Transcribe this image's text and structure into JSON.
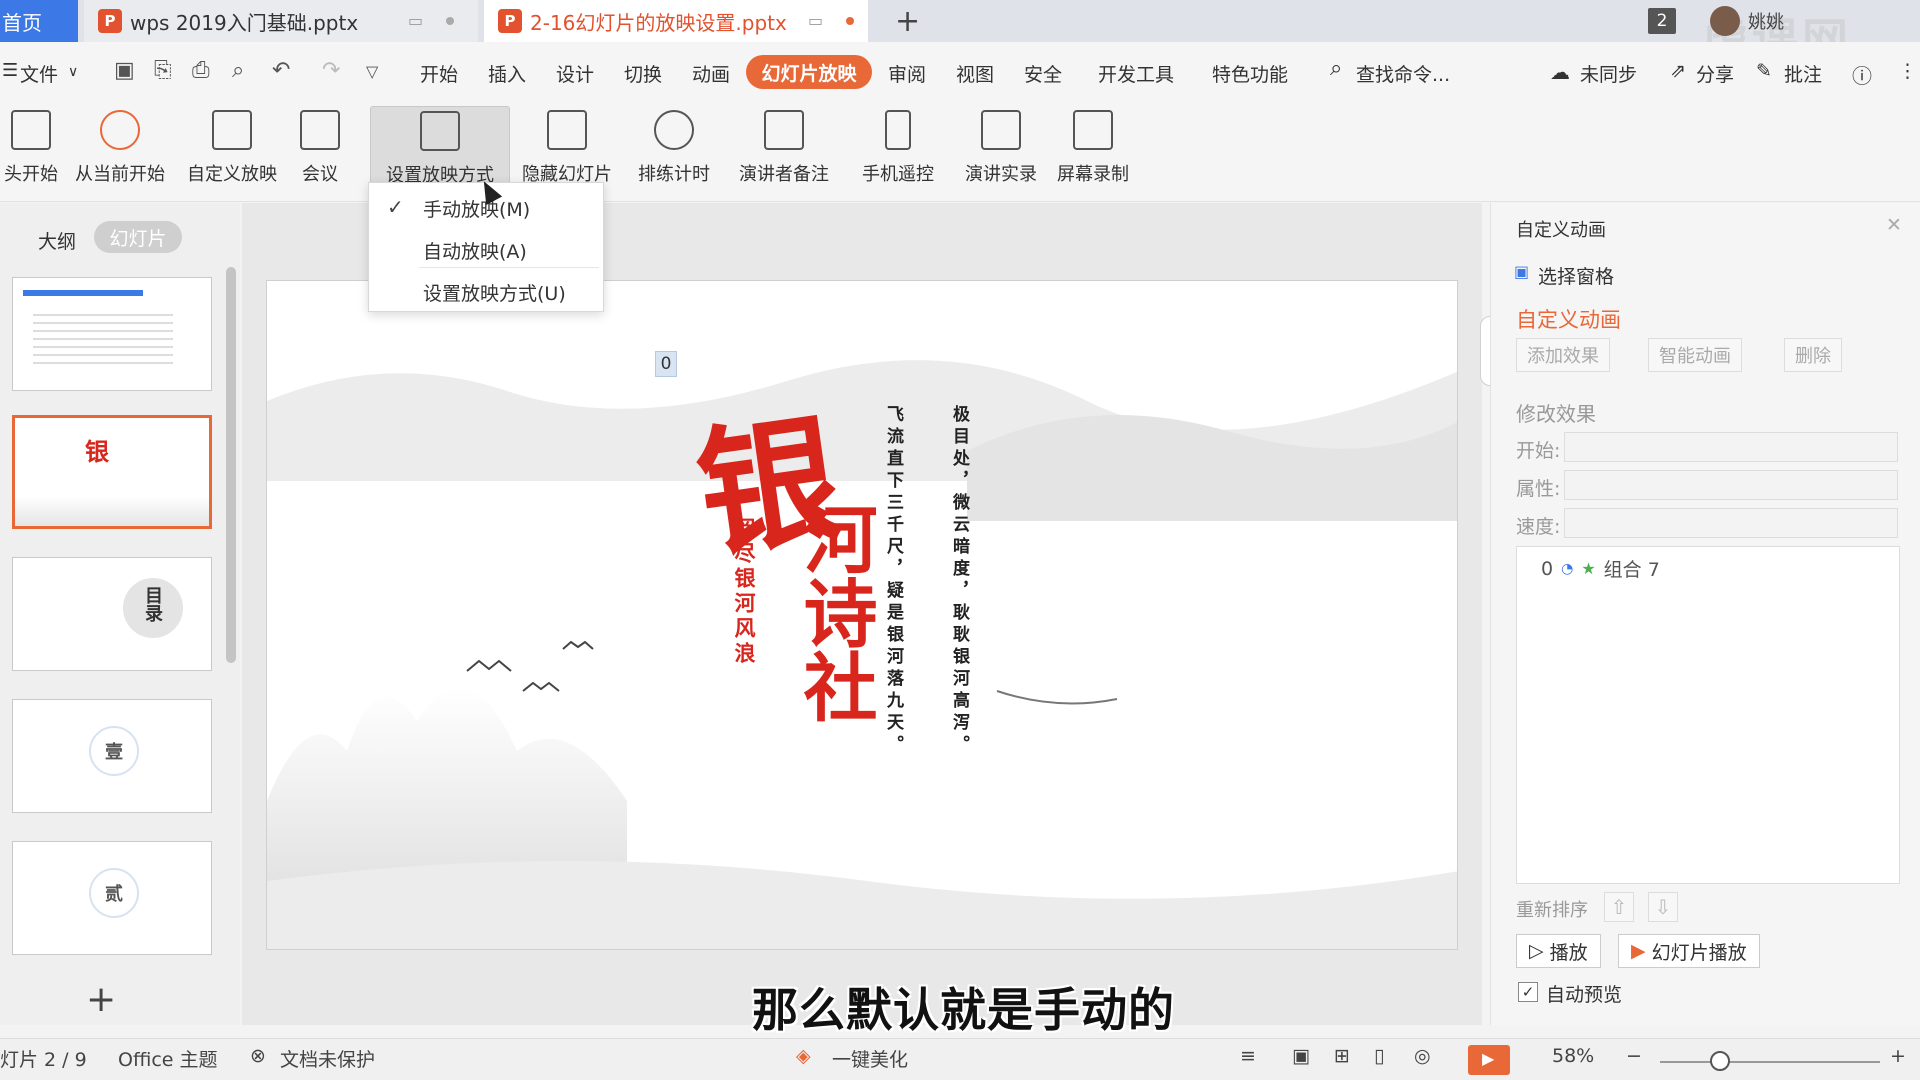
{
  "tabs": {
    "home": "首页",
    "file1": "wps 2019入门基础.pptx",
    "file2": "2-16幻灯片的放映设置.pptx",
    "window_count": "2",
    "user_name": "姚姚",
    "watermark": "虎课网"
  },
  "menu": {
    "file": "文件",
    "items": [
      "开始",
      "插入",
      "设计",
      "切换",
      "动画",
      "幻灯片放映",
      "审阅",
      "视图",
      "安全",
      "开发工具",
      "特色功能"
    ],
    "search": "查找命令...",
    "sync": "未同步",
    "share": "分享",
    "comment": "批注"
  },
  "ribbon": {
    "b0": "头开始",
    "b1": "从当前开始",
    "b2": "自定义放映",
    "b3": "会议",
    "b4": "设置放映方式",
    "b5": "隐藏幻灯片",
    "b6": "排练计时",
    "b7": "演讲者备注",
    "b8": "手机遥控",
    "b9": "演讲实录",
    "b10": "屏幕录制"
  },
  "dropdown": {
    "manual": "手动放映(M)",
    "auto": "自动放映(A)",
    "settings": "设置放映方式(U)"
  },
  "left_panel": {
    "outline_tab": "大纲",
    "slides_tab": "幻灯片"
  },
  "slide": {
    "title_first": "银",
    "title_rest": "河诗社",
    "subtitle": "阅尽银河风浪",
    "poem_col1": "飞流直下三千尺，疑是银河落九天。",
    "poem_col2": "极目处，微云暗度，耿耿银河高泻。",
    "anim_marker": "0",
    "thumb3_char": "目录",
    "thumb4_char": "壹",
    "thumb5_char": "贰"
  },
  "right_panel": {
    "header": "自定义动画",
    "select_pane": "选择窗格",
    "section_title": "自定义动画",
    "add_effect": "添加效果",
    "smart_anim": "智能动画",
    "delete": "删除",
    "modify_effect": "修改效果",
    "start_label": "开始:",
    "property_label": "属性:",
    "speed_label": "速度:",
    "list_item_index": "0",
    "list_item_name": "组合 7",
    "reorder": "重新排序",
    "play": "播放",
    "slideshow_play": "幻灯片播放",
    "auto_preview": "自动预览"
  },
  "status": {
    "slide_pos": "灯片 2 / 9",
    "theme": "Office 主题",
    "protect": "文档未保护",
    "beautify": "一键美化",
    "zoom": "58%"
  },
  "caption": "那么默认就是手动的",
  "colors": {
    "accent": "#e86838",
    "title_red": "#d8261c",
    "home_tab": "#3c78e6"
  }
}
